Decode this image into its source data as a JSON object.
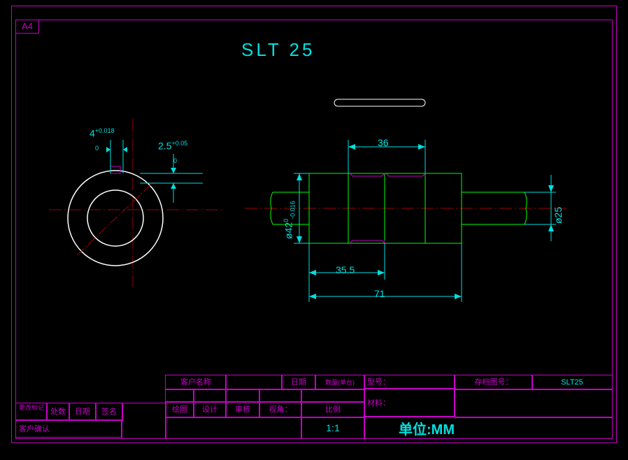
{
  "page_size": "A4",
  "title": "SLT 25",
  "dimensions": {
    "d1": {
      "val": "4",
      "lower": "0",
      "upper": "+0.018"
    },
    "d2": {
      "val": "2.5",
      "lower": "0",
      "upper": "+0.05"
    },
    "d3": {
      "val": "ø42",
      "lower": "-0.016",
      "upper": "0"
    },
    "d4": "36",
    "d5": "ø25",
    "d6": "35.5",
    "d7": "71"
  },
  "title_block": {
    "row1": [
      "客户名称",
      "",
      "日期",
      "数量(单台)",
      "型号：",
      "存档图号：",
      "SLT25"
    ],
    "row2": [
      "绘图",
      "设计",
      "审核",
      "视角：",
      "比例"
    ],
    "row3_ratio": "1:1",
    "material": "材料：",
    "unit": "单位:MM",
    "left": [
      "更改标记",
      "处数",
      "日期",
      "签名",
      "客户确认"
    ]
  }
}
